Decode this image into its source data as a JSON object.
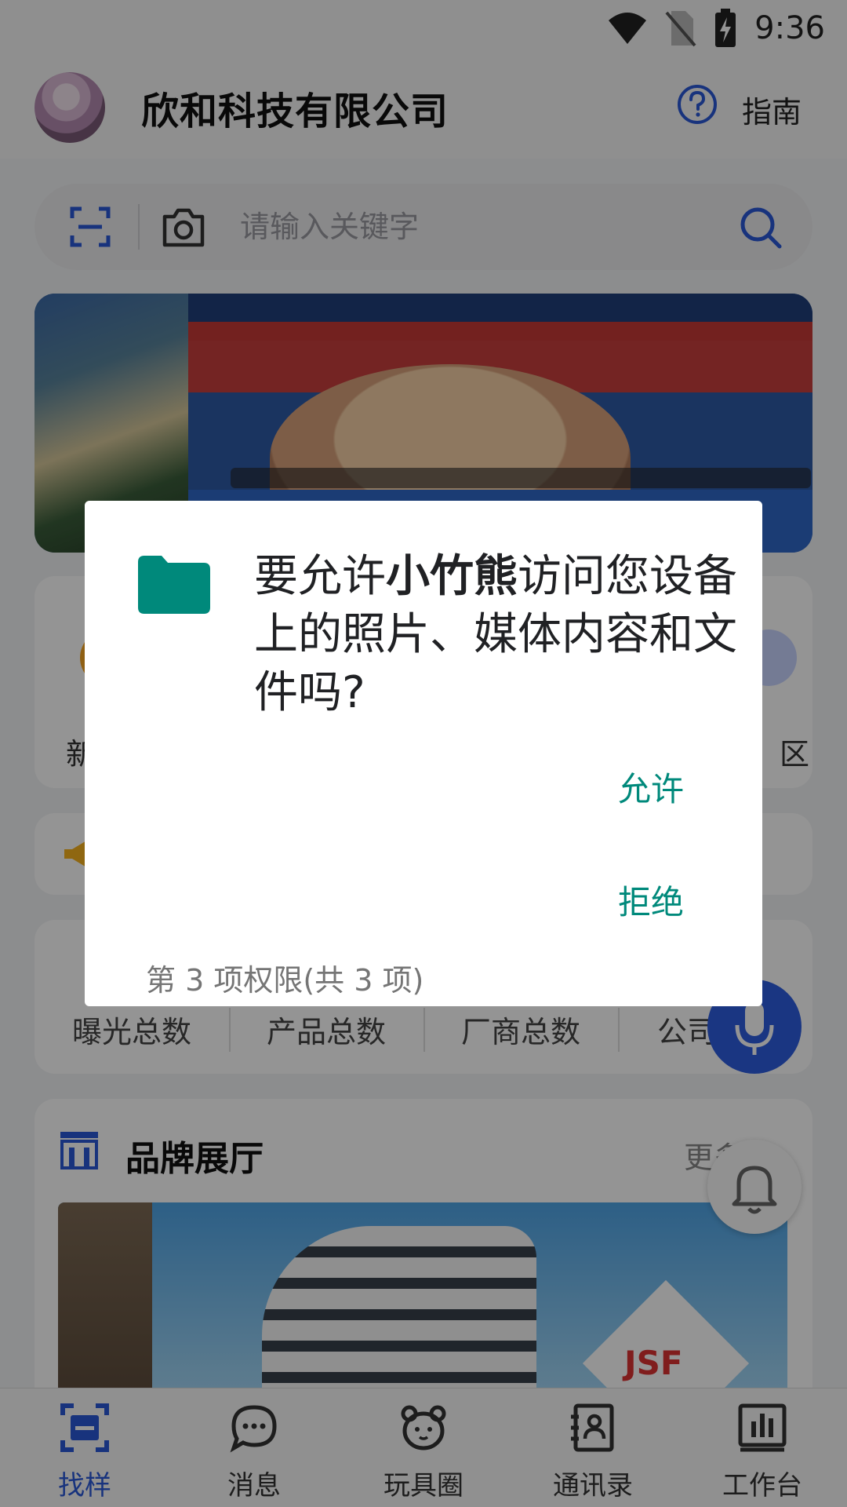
{
  "status_bar": {
    "time": "9:36"
  },
  "header": {
    "title": "欣和科技有限公司",
    "guide_label": "指南"
  },
  "search": {
    "placeholder": "请输入关键字"
  },
  "quick_entries": {
    "left_label": "新",
    "right_label": "区"
  },
  "stats": [
    "曝光总数",
    "产品总数",
    "厂商总数",
    "公司"
  ],
  "brand_section": {
    "title": "品牌展厅",
    "more_label": "更多",
    "logo_text": "JSF"
  },
  "bottom_nav": [
    {
      "label": "找样",
      "icon": "scan-box-icon",
      "active": true
    },
    {
      "label": "消息",
      "icon": "chat-bubble-icon",
      "active": false
    },
    {
      "label": "玩具圈",
      "icon": "bear-face-icon",
      "active": false
    },
    {
      "label": "通讯录",
      "icon": "contacts-book-icon",
      "active": false
    },
    {
      "label": "工作台",
      "icon": "dashboard-chart-icon",
      "active": false
    }
  ],
  "dialog": {
    "message_prefix": "要允许",
    "app_name": "小竹熊",
    "message_suffix": "访问您设备上的照片、媒体内容和文件吗?",
    "allow_label": "允许",
    "deny_label": "拒绝",
    "counter": "第 3 项权限(共 3 项)",
    "icon": "folder-icon"
  },
  "colors": {
    "accent_blue": "#2a58d8",
    "dialog_action": "#00897b",
    "folder": "#00897b"
  }
}
